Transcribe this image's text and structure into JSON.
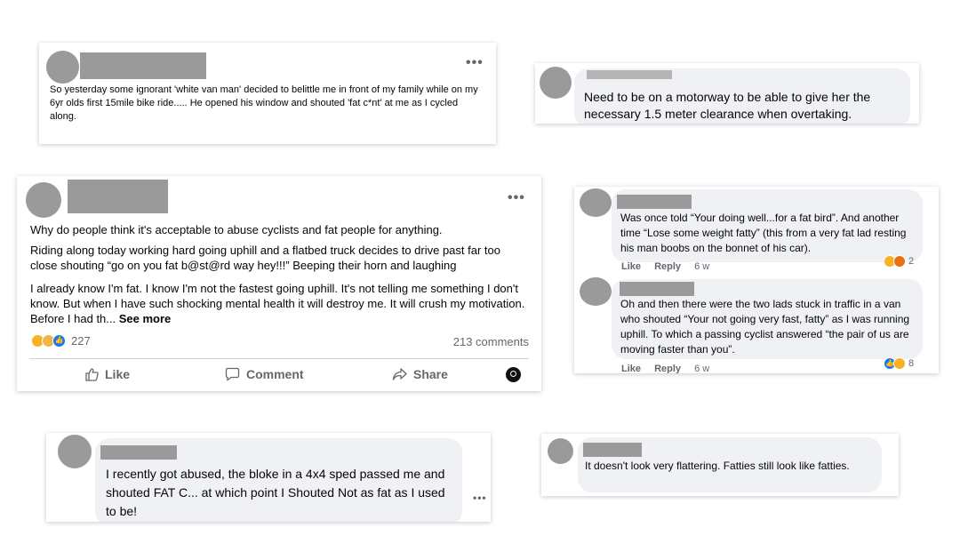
{
  "card1": {
    "menu": "•••",
    "text": "So yesterday some ignorant 'white van man' decided to belittle me in front of my family while on my 6yr olds first 15mile bike ride..... He opened his window and shouted 'fat c*nt' at me as I cycled along."
  },
  "card2": {
    "text": "Need to be on a motorway to be able to give her the necessary 1.5 meter clearance when overtaking."
  },
  "card3": {
    "menu": "•••",
    "p1": "Why do people think it's acceptable to abuse cyclists and fat people for anything.",
    "p2": "Riding along today working hard going uphill and a flatbed truck decides to drive past far too close shouting “go on you fat b@st@rd way hey!!!” Beeping their horn and laughing",
    "p3": "I already know I'm fat. I know I'm not the fastest going uphill. It's not telling me something I don't know. But when I have such shocking mental health it will destroy me. It will crush my motivation. Before I had th...",
    "see_more": "See more",
    "reaction_count": "227",
    "comments": "213 comments",
    "like": "Like",
    "comment": "Comment",
    "share": "Share"
  },
  "card4": {
    "c1_text": "Was once told “Your doing well...for a fat bird”. And another time “Lose some weight fatty” (this from a very fat lad resting his man boobs on the bonnet of his car).",
    "c1_like": "Like",
    "c1_reply": "Reply",
    "c1_age": "6 w",
    "c1_react_count": "2",
    "c2_text": "Oh and then there were the two lads stuck in traffic in a van who shouted “Your not going very fast, fatty” as I was running uphill. To which a passing cyclist answered “the pair of us are moving faster than you”.",
    "c2_like": "Like",
    "c2_reply": "Reply",
    "c2_age": "6 w",
    "c2_react_count": "8"
  },
  "card5": {
    "text": "I recently got abused, the bloke in a 4x4 sped passed me and shouted FAT C... at which point I Shouted Not as fat as I used to be!",
    "menu": "•••"
  },
  "card6": {
    "text": "It doesn't look very flattering. Fatties still look like fatties."
  }
}
